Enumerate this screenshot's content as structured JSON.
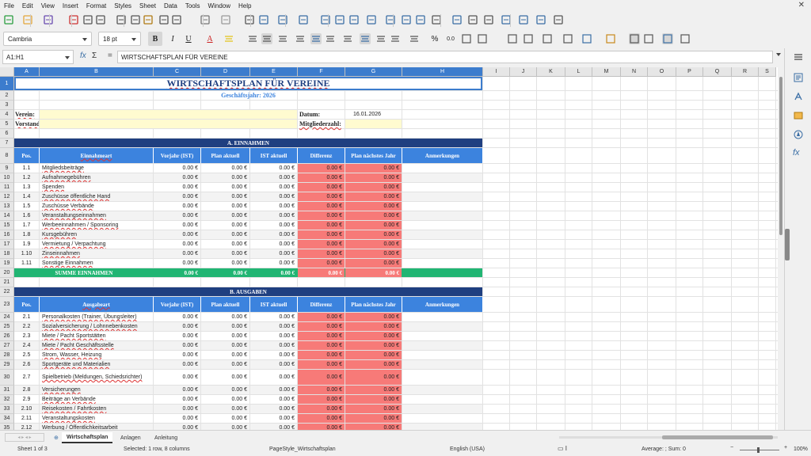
{
  "menu": [
    "File",
    "Edit",
    "View",
    "Insert",
    "Format",
    "Styles",
    "Sheet",
    "Data",
    "Tools",
    "Window",
    "Help"
  ],
  "formatting": {
    "font_name": "Cambria",
    "font_size": "18 pt",
    "bold": "B",
    "italic": "I",
    "underline": "U",
    "font_color": "A",
    "percent": "%",
    "decimal": "0.0"
  },
  "formula_bar": {
    "cell_ref": "A1:H1",
    "fx": "fx",
    "sum": "Σ",
    "eq": "=",
    "content": "WIRTSCHAFTSPLAN FÜR VEREINE"
  },
  "columns": [
    "A",
    "B",
    "C",
    "D",
    "E",
    "F",
    "G",
    "H",
    "I",
    "J",
    "K",
    "L",
    "M",
    "N",
    "O",
    "P",
    "Q",
    "R",
    "S"
  ],
  "sheet": {
    "title": "WIRTSCHAFTSPLAN FÜR VEREINE",
    "subtitle": "Geschäftsjahr: 2026",
    "verein_label": "Verein:",
    "vorstand_label": "Vorstand:",
    "datum_label": "Datum:",
    "datum_value": "16.01.2026",
    "mitglieder_label": "Mitgliederzahl:",
    "section_a": "A. EINNAHMEN",
    "section_b": "B. AUSGABEN",
    "headers_a": [
      "Pos.",
      "Einnahmeart",
      "Vorjahr (IST)",
      "Plan aktuell",
      "IST aktuell",
      "Differenz",
      "Plan nächstes Jahr",
      "Anmerkungen"
    ],
    "headers_b": [
      "Pos.",
      "Ausgabeart",
      "Vorjahr (IST)",
      "Plan aktuell",
      "IST aktuell",
      "Differenz",
      "Plan nächstes Jahr",
      "Anmerkungen"
    ],
    "zero": "0.00 €",
    "income": [
      {
        "pos": "1.1",
        "name": "Mitgliedsbeiträge"
      },
      {
        "pos": "1.2",
        "name": "Aufnahmegebühren"
      },
      {
        "pos": "1.3",
        "name": "Spenden"
      },
      {
        "pos": "1.4",
        "name": "Zuschüsse öffentliche Hand"
      },
      {
        "pos": "1.5",
        "name": "Zuschüsse Verbände"
      },
      {
        "pos": "1.6",
        "name": "Veranstaltungseinnahmen"
      },
      {
        "pos": "1.7",
        "name": "Werbeeinnahmen / Sponsoring"
      },
      {
        "pos": "1.8",
        "name": "Kursgebühren"
      },
      {
        "pos": "1.9",
        "name": "Vermietung / Verpachtung"
      },
      {
        "pos": "1.10",
        "name": "Zinseinnahmen"
      },
      {
        "pos": "1.11",
        "name": "Sonstige Einnahmen"
      }
    ],
    "sum_income_label": "SUMME EINNAHMEN",
    "expenses": [
      {
        "pos": "2.1",
        "name": "Personalkosten (Trainer, Übungsleiter)"
      },
      {
        "pos": "2.2",
        "name": "Sozialversicherung / Lohnnebenkosten"
      },
      {
        "pos": "2.3",
        "name": "Miete / Pacht Sportstätten"
      },
      {
        "pos": "2.4",
        "name": "Miete / Pacht Geschäftsstelle"
      },
      {
        "pos": "2.5",
        "name": "Strom, Wasser, Heizung"
      },
      {
        "pos": "2.6",
        "name": "Sportgeräte und Materialien"
      },
      {
        "pos": "2.7",
        "name": "Spielbetrieb (Meldungen, Schiedsrichter)"
      },
      {
        "pos": "2.8",
        "name": "Versicherungen"
      },
      {
        "pos": "2.9",
        "name": "Beiträge an Verbände"
      },
      {
        "pos": "2.10",
        "name": "Reisekosten / Fahrtkosten"
      },
      {
        "pos": "2.11",
        "name": "Veranstaltungskosten"
      },
      {
        "pos": "2.12",
        "name": "Werbung / Öffentlichkeitsarbeit"
      }
    ]
  },
  "tabs": [
    "Wirtschaftsplan",
    "Anlagen",
    "Anleitung"
  ],
  "tab_add": "⊕",
  "status": {
    "sheet": "Sheet 1 of 3",
    "selection": "Selected: 1 row, 8 columns",
    "page_style": "PageStyle_Wirtschaftsplan",
    "language": "English (USA)",
    "summary": "Average: ; Sum: 0",
    "zoom": "100%"
  }
}
